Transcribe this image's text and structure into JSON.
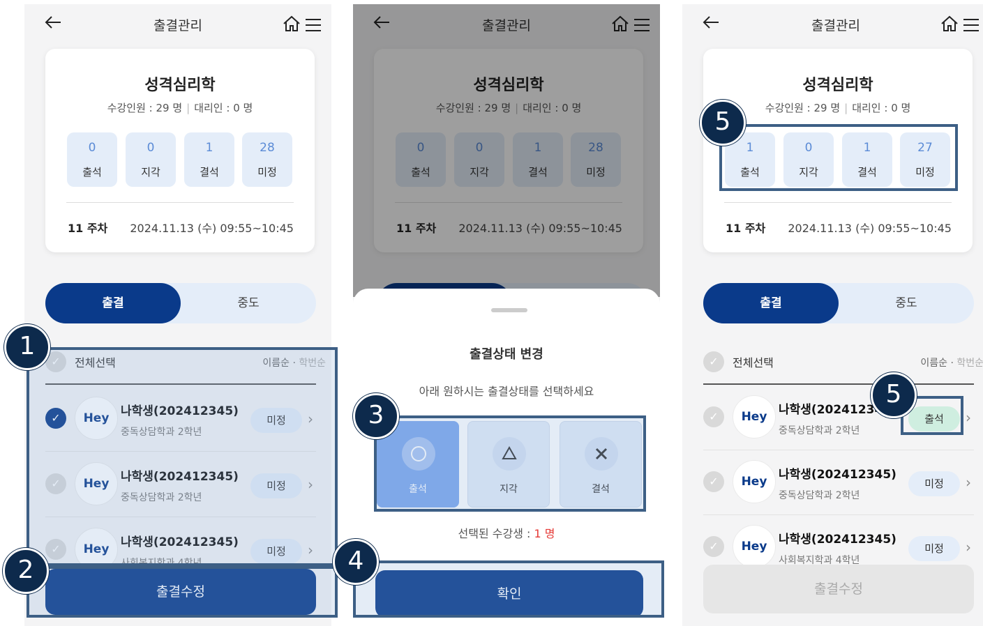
{
  "header": {
    "title": "출결관리"
  },
  "course": {
    "name": "성격심리학",
    "enrolled": "수강인원 : 29 명",
    "proxy": "대리인 : 0 명",
    "week": "11 주차",
    "datetime": "2024.11.13 (수) 09:55~10:45"
  },
  "stat_labels": [
    "출석",
    "지각",
    "결석",
    "미정"
  ],
  "stats_before": [
    "0",
    "0",
    "1",
    "28"
  ],
  "stats_after": [
    "1",
    "0",
    "1",
    "27"
  ],
  "tabs": {
    "attendance": "출결",
    "midway": "중도"
  },
  "select_all": "전체선택",
  "sort": {
    "name": "이름순",
    "sep": "·",
    "id": "학번순"
  },
  "students": [
    {
      "name": "나학생(202412345)",
      "dept": "중독상담학과 2학년"
    },
    {
      "name": "나학생(202412345)",
      "dept": "중독상담학과 2학년"
    },
    {
      "name": "나학생(202412345)",
      "dept": "사회복지학과 4학년"
    }
  ],
  "panel3_names": [
    "나학생(20241234",
    "나학생(202412345)",
    "나학생(202412345)"
  ],
  "avatar_text": "Hey",
  "status": {
    "undecided": "미정",
    "present": "출석"
  },
  "modify_button": "출결수정",
  "sheet": {
    "title": "출결상태 변경",
    "desc": "아래 원하시는 출결상태를 선택하세요",
    "options": [
      "출석",
      "지각",
      "결석"
    ],
    "selected_label": "선택된 수강생 : ",
    "selected_count": "1 명",
    "confirm": "확인"
  },
  "markers": [
    "1",
    "2",
    "3",
    "4",
    "5",
    "5"
  ],
  "icons": {
    "back": "arrow-left-icon",
    "home": "home-icon",
    "menu": "hamburger-menu-icon",
    "check": "check-icon",
    "chevron": "chevron-right-icon"
  },
  "colors": {
    "primary": "#0a3a8a",
    "stat_bg": "#e4edf9",
    "stat_num": "#5b8bd6",
    "marker": "#0d2a4c",
    "highlight": "#3d5f85",
    "red": "#e53935",
    "present_badge": "#cfeee0"
  }
}
